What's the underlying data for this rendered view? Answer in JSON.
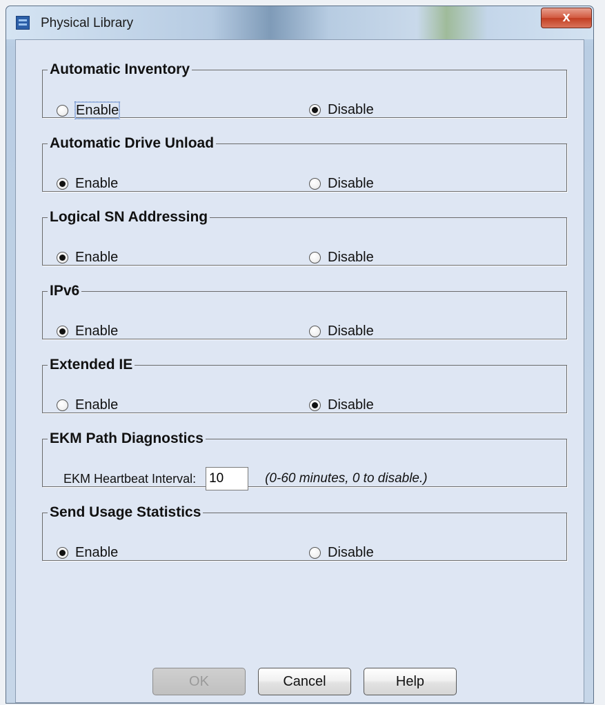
{
  "window": {
    "title": "Physical Library",
    "close_label": "x"
  },
  "groups": [
    {
      "title": "Automatic Inventory",
      "enable_label": "Enable",
      "disable_label": "Disable",
      "selected": "disable"
    },
    {
      "title": "Automatic Drive Unload",
      "enable_label": "Enable",
      "disable_label": "Disable",
      "selected": "enable"
    },
    {
      "title": "Logical SN Addressing",
      "enable_label": "Enable",
      "disable_label": "Disable",
      "selected": "enable"
    },
    {
      "title": "IPv6",
      "enable_label": "Enable",
      "disable_label": "Disable",
      "selected": "enable"
    },
    {
      "title": "Extended IE",
      "enable_label": "Enable",
      "disable_label": "Disable",
      "selected": "disable"
    }
  ],
  "ekm": {
    "title": "EKM Path Diagnostics",
    "label": "EKM Heartbeat Interval:",
    "value": "10",
    "hint": "(0-60 minutes, 0 to disable.)"
  },
  "usage": {
    "title": "Send Usage Statistics",
    "enable_label": "Enable",
    "disable_label": "Disable",
    "selected": "enable"
  },
  "buttons": {
    "ok": "OK",
    "cancel": "Cancel",
    "help": "Help",
    "ok_enabled": false
  }
}
